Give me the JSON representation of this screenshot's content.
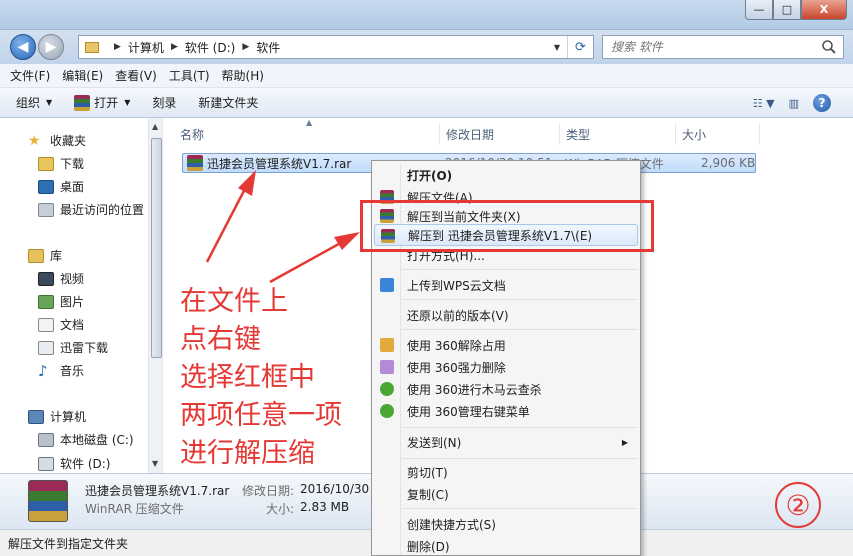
{
  "window": {
    "minimize": "—",
    "maximize": "□",
    "close": "X"
  },
  "nav": {
    "back": "◀",
    "forward": "▶",
    "breadcrumb": [
      "计算机",
      "软件 (D:)",
      "软件"
    ],
    "search_placeholder": "搜索 软件"
  },
  "menubar": [
    "文件(F)",
    "编辑(E)",
    "查看(V)",
    "工具(T)",
    "帮助(H)"
  ],
  "toolbar": {
    "organize": "组织",
    "open": "打开",
    "burn": "刻录",
    "new_folder": "新建文件夹"
  },
  "navpane": {
    "favorites": "收藏夹",
    "fav_items": [
      "下载",
      "桌面",
      "最近访问的位置"
    ],
    "library": "库",
    "lib_items": [
      "视频",
      "图片",
      "文档",
      "迅雷下载",
      "音乐"
    ],
    "computer": "计算机",
    "drives": [
      "本地磁盘 (C:)",
      "软件 (D:)"
    ]
  },
  "columns": {
    "name": "名称",
    "date": "修改日期",
    "type": "类型",
    "size": "大小"
  },
  "file": {
    "name": "迅捷会员管理系统V1.7.rar",
    "date": "2016/10/30 10:51",
    "type": "WinRAR 压缩文件",
    "size": "2,906 KB"
  },
  "details": {
    "name": "迅捷会员管理系统V1.7.rar",
    "date_label": "修改日期:",
    "date": "2016/10/30 1",
    "type": "WinRAR 压缩文件",
    "size_label": "大小:",
    "size": "2.83 MB"
  },
  "status": "解压文件到指定文件夹",
  "context_menu": [
    "打开(O)",
    "解压文件(A)...",
    "解压到当前文件夹(X)",
    "解压到 迅捷会员管理系统V1.7\\(E)",
    "打开方式(H)...",
    "上传到WPS云文档",
    "还原以前的版本(V)",
    "使用 360解除占用",
    "使用 360强力删除",
    "使用 360进行木马云查杀",
    "使用 360管理右键菜单",
    "发送到(N)",
    "剪切(T)",
    "复制(C)",
    "创建快捷方式(S)",
    "删除(D)"
  ],
  "annotation": {
    "lines": [
      "在文件上",
      "点右键",
      "选择红框中",
      "两项任意一项",
      "进行解压缩"
    ],
    "step": "②"
  },
  "colors": {
    "annotation_red": "#e53935",
    "selection_blue": "#c1dcfc",
    "nav_blue": "#c1d3ea"
  }
}
